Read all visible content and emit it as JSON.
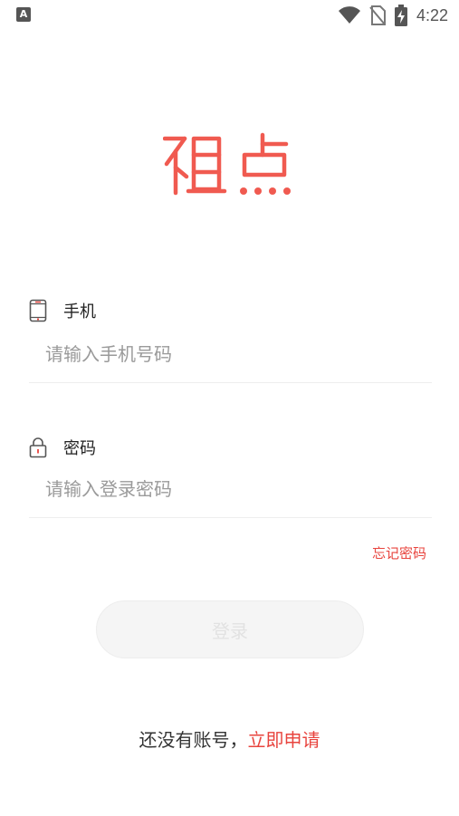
{
  "status_bar": {
    "left_icon_text": "A",
    "time": "4:22",
    "icons": [
      "wifi-icon",
      "no-sim-icon",
      "battery-charging-icon"
    ]
  },
  "brand": {
    "logo_text": "租点",
    "color": "#f05a50"
  },
  "phone": {
    "label": "手机",
    "placeholder": "请输入手机号码",
    "value": "",
    "icon": "phone-icon"
  },
  "password": {
    "label": "密码",
    "placeholder": "请输入登录密码",
    "value": "",
    "icon": "lock-icon"
  },
  "forgot_password": "忘记密码",
  "login_button": "登录",
  "register": {
    "prompt": "还没有账号，",
    "link": "立即申请"
  },
  "colors": {
    "accent": "#e8443e",
    "button_bg": "#f5f5f5",
    "button_text": "#e2e2e2"
  }
}
